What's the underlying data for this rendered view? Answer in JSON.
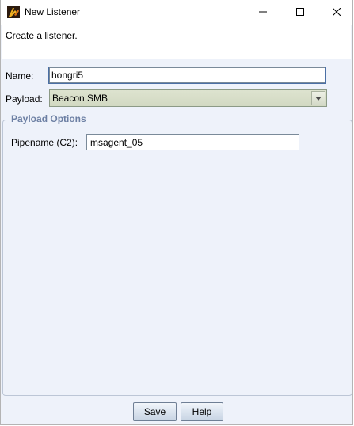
{
  "window": {
    "title": "New Listener"
  },
  "banner": {
    "text": "Create a listener."
  },
  "form": {
    "name_label": "Name:",
    "name_value": "hongri5",
    "payload_label": "Payload:",
    "payload_value": "Beacon SMB"
  },
  "payload_options": {
    "title": "Payload Options",
    "pipename_label": "Pipename (C2):",
    "pipename_value": "msagent_05"
  },
  "buttons": {
    "save": "Save",
    "help": "Help"
  },
  "icons": {
    "app": "cobalt-strike-app-icon",
    "minimize": "minimize-icon",
    "maximize": "maximize-icon",
    "close": "close-icon",
    "dropdown": "chevron-down-icon"
  }
}
